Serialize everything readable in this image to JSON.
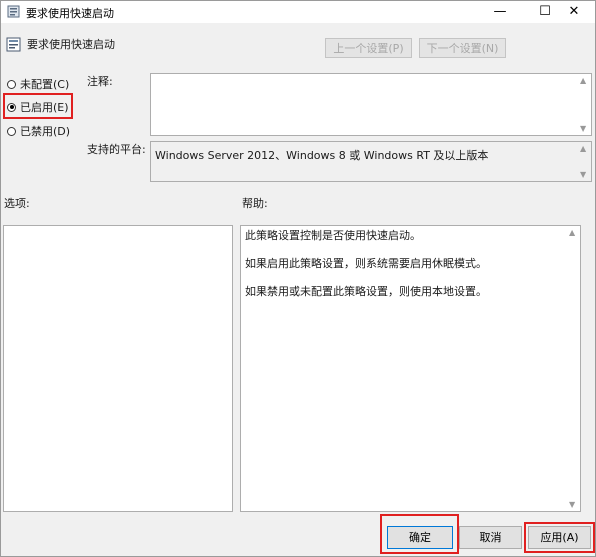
{
  "window": {
    "title": "要求使用快速启动",
    "minimize": "—",
    "maximize": "☐",
    "close": "✕"
  },
  "header": {
    "title": "要求使用快速启动",
    "prev_label": "上一个设置(P)",
    "next_label": "下一个设置(N)"
  },
  "state": {
    "options": [
      {
        "label": "未配置(C)",
        "selected": false
      },
      {
        "label": "已启用(E)",
        "selected": true
      },
      {
        "label": "已禁用(D)",
        "selected": false
      }
    ]
  },
  "comment": {
    "label": "注释:",
    "value": ""
  },
  "platform": {
    "label": "支持的平台:",
    "value": "Windows Server 2012、Windows 8 或 Windows RT 及以上版本"
  },
  "options_panel": {
    "label": "选项:"
  },
  "help": {
    "label": "帮助:",
    "paragraphs": [
      "此策略设置控制是否使用快速启动。",
      "如果启用此策略设置，则系统需要启用休眠模式。",
      "如果禁用或未配置此策略设置，则使用本地设置。"
    ]
  },
  "buttons": {
    "ok": "确定",
    "cancel": "取消",
    "apply": "应用(A)"
  },
  "colors": {
    "highlight": "#e02020",
    "accent": "#0078d7"
  },
  "icons": {
    "title": "policy-icon",
    "header": "policy-setting-icon"
  }
}
